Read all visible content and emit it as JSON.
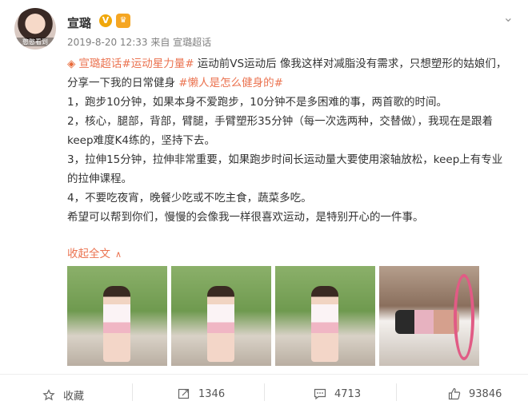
{
  "header": {
    "avatar_text": "憨憨看到",
    "username": "宣璐",
    "v_badge": "V",
    "member_icon": "crown-icon",
    "menu_icon": "chevron-down-icon"
  },
  "meta": {
    "time": "2019-8-20 12:33",
    "from_label": "来自",
    "source": "宣璐超话"
  },
  "content": {
    "lead_icon": "diamond-icon",
    "topic_1": "宣璐超话",
    "topic_2": "#运动星力量#",
    "text_1": " 运动前VS运动后 像我这样对减脂没有需求，只想塑形的姑娘们，分享一下我的日常健身 ",
    "topic_3": "#懒人是怎么健身的#",
    "line_1": "1，跑步10分钟，如果本身不爱跑步，10分钟不是多困难的事，两首歌的时间。",
    "line_2": "2，核心，腿部，背部，臂腿，手臂塑形35分钟（每一次选两种，交替做），我现在是跟着keep难度K4练的，坚持下去。",
    "line_3": "3，拉伸15分钟，拉伸非常重要，如果跑步时间长运动量大要使用滚轴放松，keep上有专业的拉伸课程。",
    "line_4": "4，不要吃夜宵，晚餐少吃或不吃主食，蔬菜多吃。",
    "line_5": "希望可以帮到你们，慢慢的会像我一样很喜欢运动，是特别开心的一件事。",
    "collapse_label": "收起全文",
    "collapse_icon": "chevron-up-icon"
  },
  "photos": [
    "photo-1",
    "photo-2",
    "photo-3",
    "photo-4-gym"
  ],
  "actions": {
    "favorite_label": "收藏",
    "repost_count": "1346",
    "comment_count": "4713",
    "like_count": "93846"
  },
  "colors": {
    "accent": "#eb7350",
    "text": "#333333",
    "meta": "#808080",
    "v_badge": "#f0a70a"
  }
}
